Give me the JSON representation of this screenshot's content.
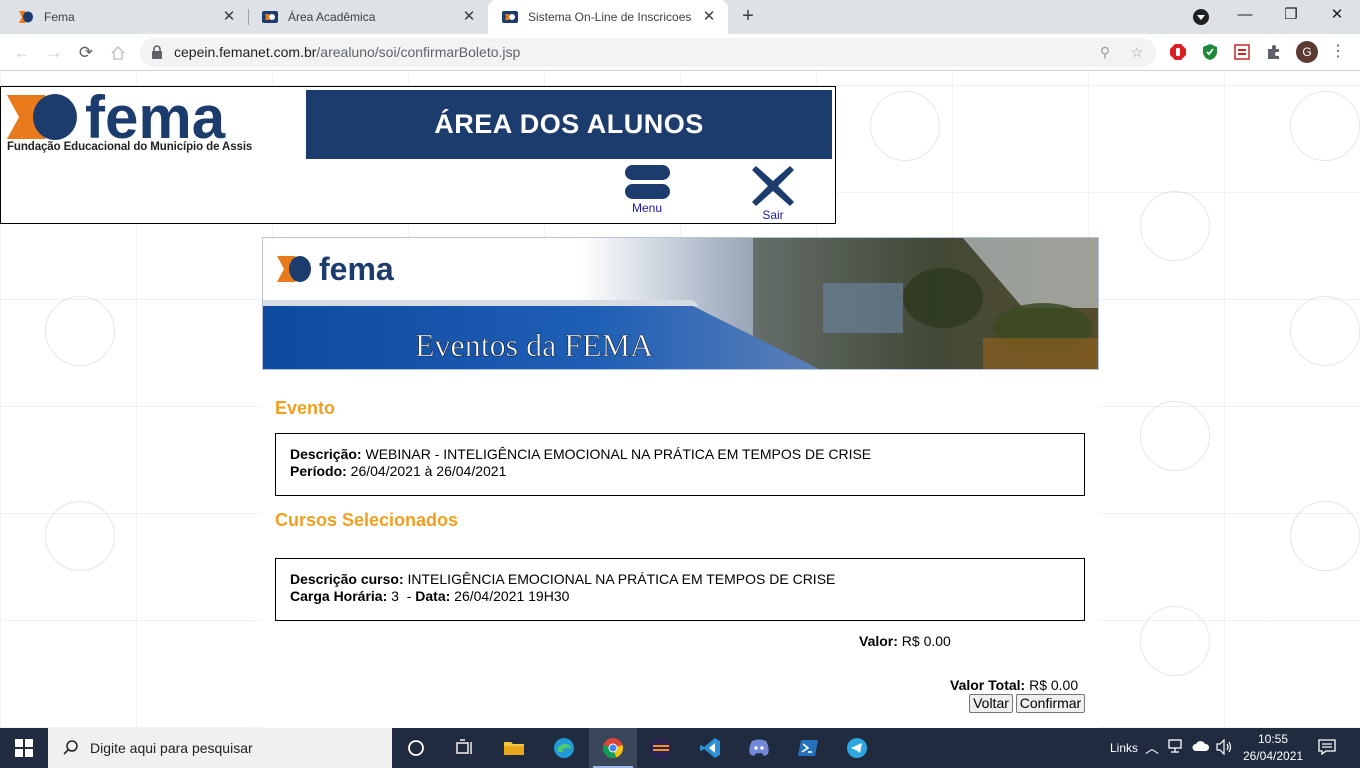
{
  "browser": {
    "tabs": [
      {
        "title": "Fema",
        "active": false
      },
      {
        "title": "Área Acadêmica",
        "active": false
      },
      {
        "title": "Sistema On-Line de Inscricoes",
        "active": true
      }
    ],
    "url_host": "cepein.femanet.com.br",
    "url_path": "/arealuno/soi/confirmarBoleto.jsp",
    "avatar_letter": "G"
  },
  "header": {
    "logo_text": "fema",
    "logo_tagline": "Fundação Educacional do Município de Assis",
    "area_title": "ÁREA DOS ALUNOS",
    "menu_label": "Menu",
    "sair_label": "Sair"
  },
  "banner": {
    "logo_text": "fema",
    "title": "Eventos da FEMA"
  },
  "evento": {
    "section_title": "Evento",
    "descricao_label": "Descrição:",
    "descricao_value": " WEBINAR - INTELIGÊNCIA EMOCIONAL NA PRÁTICA EM TEMPOS DE CRISE",
    "periodo_label": "Período:",
    "periodo_value": " 26/04/2021 à 26/04/2021"
  },
  "cursos": {
    "section_title": "Cursos Selecionados",
    "descricao_label": "Descrição curso:",
    "descricao_value": " INTELIGÊNCIA EMOCIONAL NA PRÁTICA EM TEMPOS DE CRISE",
    "carga_label": "Carga Horária:",
    "carga_value": " 3  - ",
    "data_label": "Data:",
    "data_value": " 26/04/2021 19H30",
    "valor_label": "Valor:",
    "valor_value": " R$ 0.00"
  },
  "totals": {
    "valor_total_label": "Valor Total:",
    "valor_total_value": " R$ 0.00",
    "voltar_label": "Voltar",
    "confirmar_label": "Confirmar"
  },
  "taskbar": {
    "search_placeholder": "Digite aqui para pesquisar",
    "links_label": "Links",
    "time": "10:55",
    "date": "26/04/2021"
  },
  "colors": {
    "navy": "#1d3c6e",
    "orange": "#f0a020",
    "link_blue": "#1a1aa6"
  }
}
